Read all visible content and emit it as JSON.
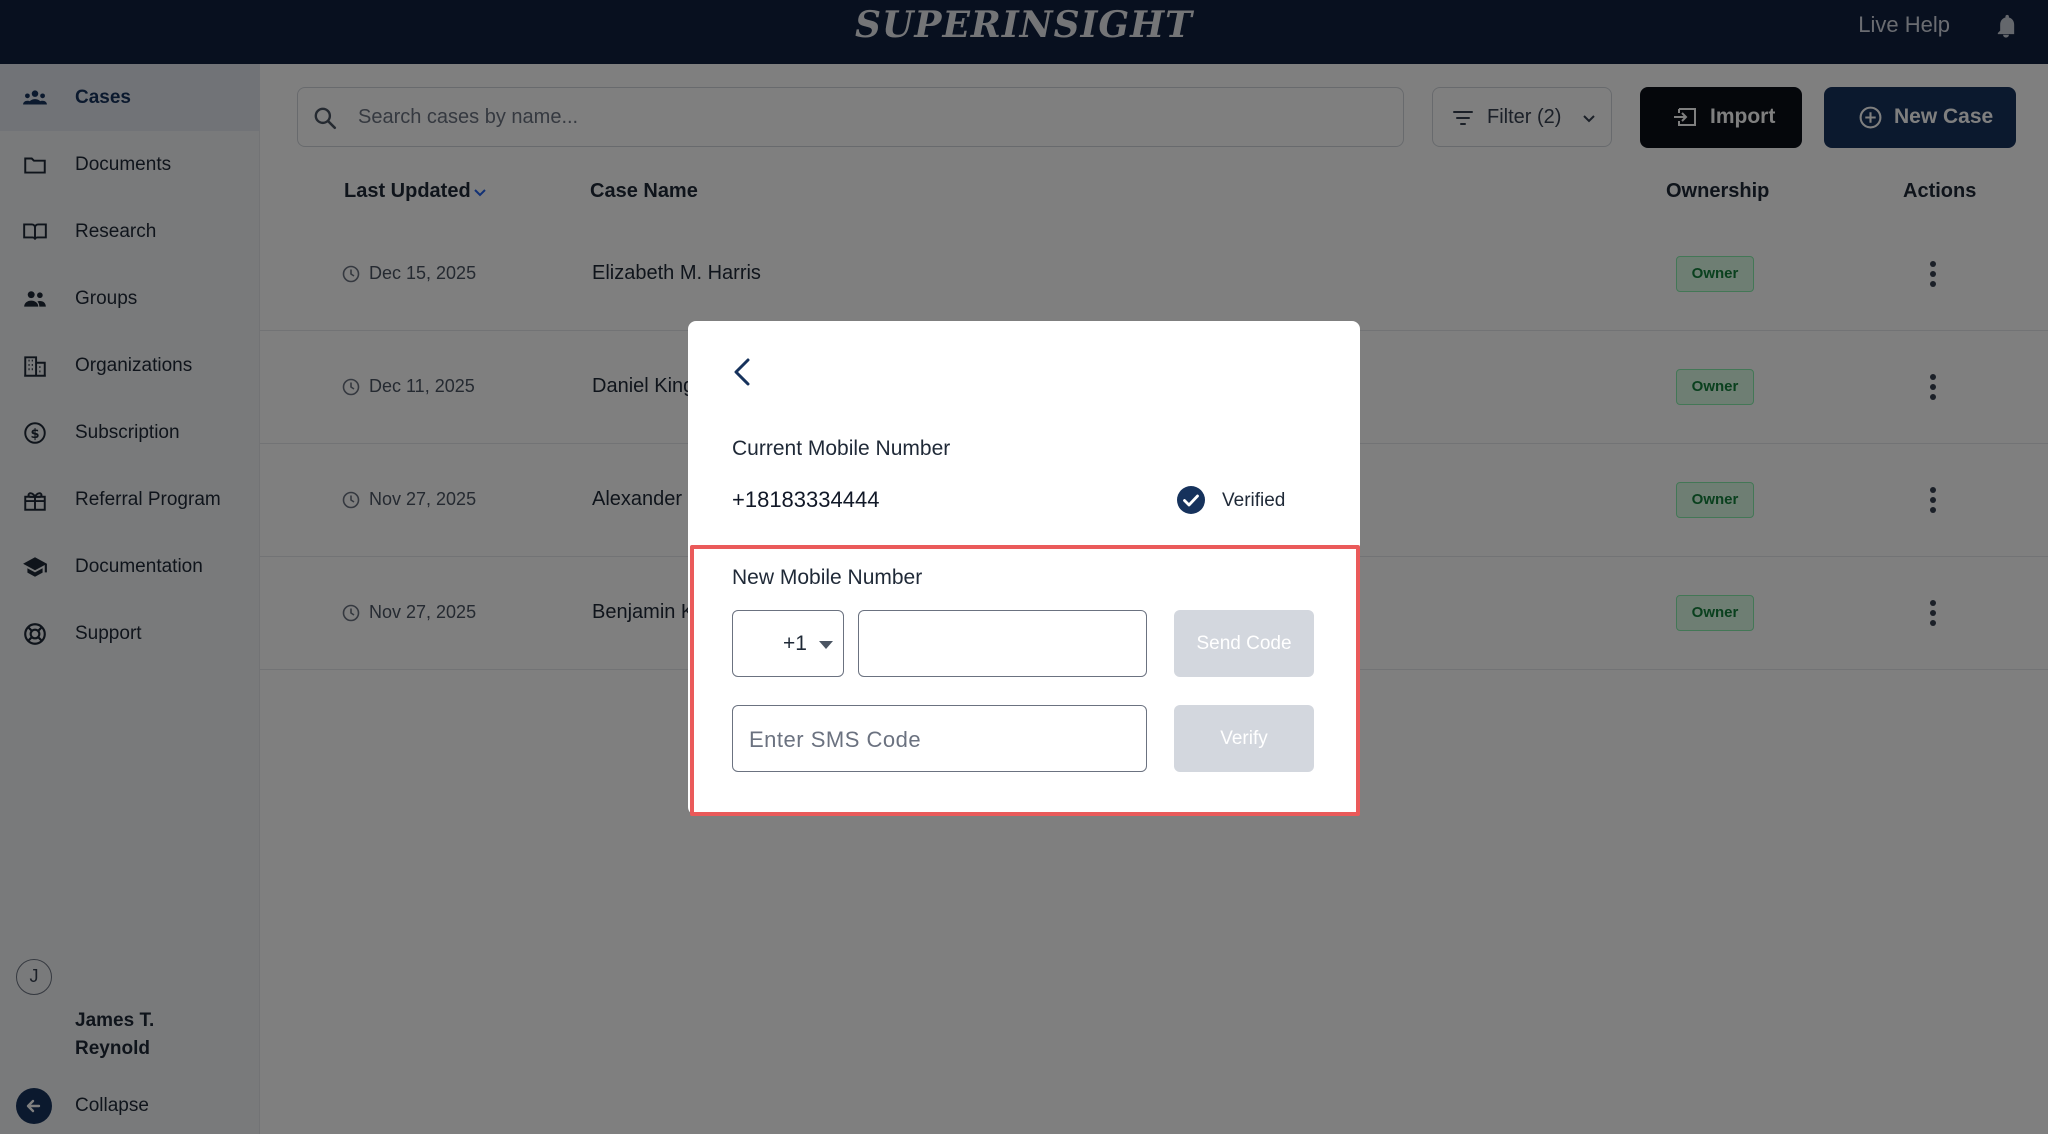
{
  "app": {
    "brand": "SUPERINSIGHT",
    "live_help": "Live Help",
    "bell_icon": "bell-icon"
  },
  "sidebar": {
    "items": [
      {
        "label": "Cases",
        "icon": "users-group-icon",
        "active": true
      },
      {
        "label": "Documents",
        "icon": "folder-icon"
      },
      {
        "label": "Research",
        "icon": "book-open-icon"
      },
      {
        "label": "Groups",
        "icon": "people-icon"
      },
      {
        "label": "Organizations",
        "icon": "building-icon"
      },
      {
        "label": "Subscription",
        "icon": "dollar-circle-icon"
      },
      {
        "label": "Referral Program",
        "icon": "gift-icon"
      },
      {
        "label": "Documentation",
        "icon": "graduation-cap-icon"
      },
      {
        "label": "Support",
        "icon": "lifebuoy-icon"
      }
    ],
    "user": {
      "initial": "J",
      "name": "James T. Reynold"
    },
    "collapse_label": "Collapse"
  },
  "toolbar": {
    "search_placeholder": "Search cases by name...",
    "filter_label": "Filter (2)",
    "import_label": "Import",
    "new_case_label": "New Case"
  },
  "table": {
    "headers": {
      "last_updated": "Last Updated",
      "case_name": "Case Name",
      "ownership": "Ownership",
      "actions": "Actions"
    },
    "rows": [
      {
        "date": "Dec 15, 2025",
        "name": "Elizabeth M. Harris",
        "ownership": "Owner"
      },
      {
        "date": "Dec 11, 2025",
        "name": "Daniel King",
        "ownership": "Owner"
      },
      {
        "date": "Nov 27, 2025",
        "name": "Alexander",
        "ownership": "Owner"
      },
      {
        "date": "Nov 27, 2025",
        "name": "Benjamin K",
        "ownership": "Owner"
      }
    ]
  },
  "modal": {
    "current_label": "Current Mobile Number",
    "current_number": "+18183334444",
    "verified_label": "Verified",
    "new_label": "New Mobile Number",
    "country_code": "+1",
    "phone_value": "",
    "send_code_label": "Send Code",
    "sms_placeholder": "Enter SMS Code",
    "verify_label": "Verify",
    "highlight_color": "#ea5a5a"
  },
  "colors": {
    "brand_navy": "#16325c",
    "topbar": "#10213f",
    "disabled_button": "#d3d7de",
    "owner_badge_text": "#15803d"
  }
}
